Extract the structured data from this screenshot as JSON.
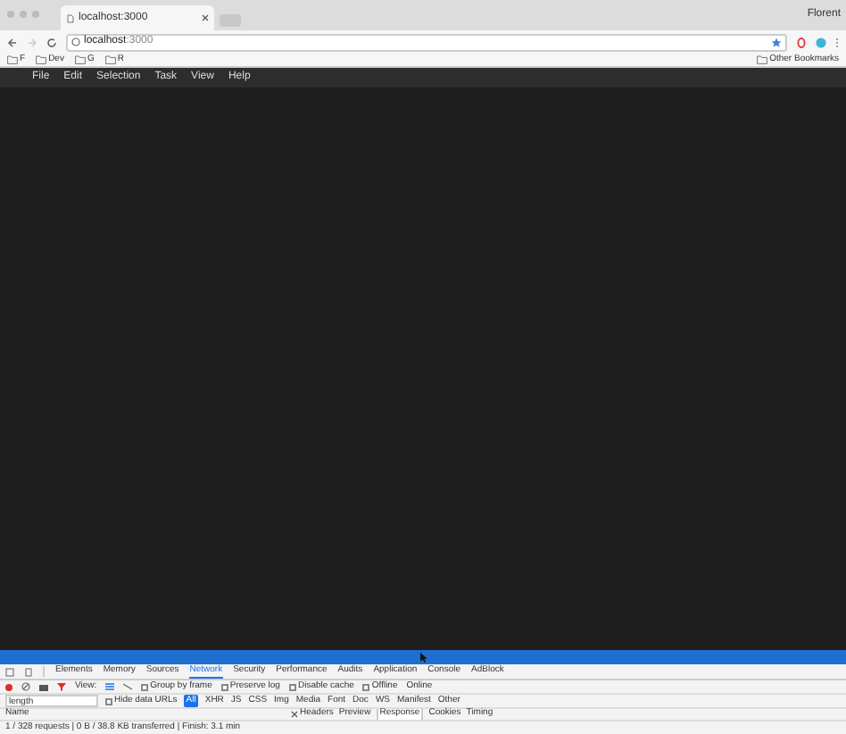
{
  "browser": {
    "tab": {
      "title": "localhost:3000"
    },
    "profile": "Florent",
    "address": {
      "host": "localhost",
      "port": ":3000"
    },
    "bookmarks": [
      {
        "label": "F"
      },
      {
        "label": "Dev"
      },
      {
        "label": "G"
      },
      {
        "label": "R"
      }
    ],
    "other_bookmarks": "Other Bookmarks"
  },
  "app": {
    "menu": [
      "File",
      "Edit",
      "Selection",
      "Task",
      "View",
      "Help"
    ]
  },
  "devtools": {
    "tabs": [
      {
        "label": "Elements",
        "selected": false
      },
      {
        "label": "Memory",
        "selected": false
      },
      {
        "label": "Sources",
        "selected": false
      },
      {
        "label": "Network",
        "selected": true
      },
      {
        "label": "Security",
        "selected": false
      },
      {
        "label": "Performance",
        "selected": false
      },
      {
        "label": "Audits",
        "selected": false
      },
      {
        "label": "Application",
        "selected": false
      },
      {
        "label": "Console",
        "selected": false
      },
      {
        "label": "AdBlock",
        "selected": false
      }
    ],
    "toolbar": {
      "view_label": "View:",
      "options": [
        {
          "label": "Group by frame",
          "checked": false
        },
        {
          "label": "Preserve log",
          "checked": false
        },
        {
          "label": "Disable cache",
          "checked": false
        },
        {
          "label": "Offline",
          "checked": false
        }
      ],
      "throttle": "Online"
    },
    "filter": {
      "value": "length",
      "hide_data_urls": {
        "label": "Hide data URLs",
        "checked": false
      },
      "types": [
        {
          "label": "All",
          "selected": true
        },
        {
          "label": "XHR",
          "selected": false
        },
        {
          "label": "JS",
          "selected": false
        },
        {
          "label": "CSS",
          "selected": false
        },
        {
          "label": "Img",
          "selected": false
        },
        {
          "label": "Media",
          "selected": false
        },
        {
          "label": "Font",
          "selected": false
        },
        {
          "label": "Doc",
          "selected": false
        },
        {
          "label": "WS",
          "selected": false
        },
        {
          "label": "Manifest",
          "selected": false
        },
        {
          "label": "Other",
          "selected": false
        }
      ]
    },
    "name_column": "Name",
    "detail_tabs": [
      {
        "label": "Headers",
        "selected": false
      },
      {
        "label": "Preview",
        "selected": false
      },
      {
        "label": "Response",
        "selected": true
      },
      {
        "label": "Cookies",
        "selected": false
      },
      {
        "label": "Timing",
        "selected": false
      }
    ],
    "status": "1 / 328 requests | 0 B / 38.8 KB transferred | Finish: 3.1 min"
  }
}
